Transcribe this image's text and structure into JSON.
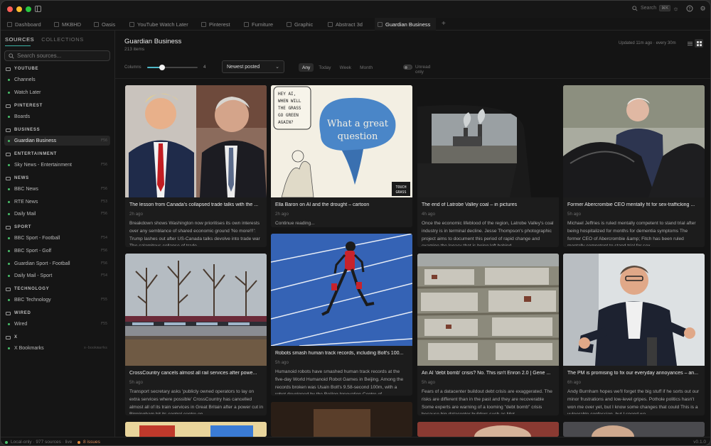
{
  "titlebar": {
    "search_label": "Search",
    "search_shortcut": "⌘K"
  },
  "tabs": [
    {
      "label": "Dashboard",
      "active": false
    },
    {
      "label": "MKBHD",
      "active": false
    },
    {
      "label": "Oasis",
      "active": false
    },
    {
      "label": "YouTube Watch Later",
      "active": false
    },
    {
      "label": "Pinterest",
      "active": false
    },
    {
      "label": "Furniture",
      "active": false
    },
    {
      "label": "Graphic",
      "active": false
    },
    {
      "label": "Abstract 3d",
      "active": false
    },
    {
      "label": "Guardian Business",
      "active": true
    }
  ],
  "sidebar": {
    "tab_sources": "SOURCES",
    "tab_collections": "COLLECTIONS",
    "search_placeholder": "Search sources...",
    "groups": [
      {
        "name": "YOUTUBE",
        "items": [
          {
            "label": "Channels",
            "key": ""
          },
          {
            "label": "Watch Later",
            "key": ""
          }
        ]
      },
      {
        "name": "PINTEREST",
        "items": [
          {
            "label": "Boards",
            "key": ""
          }
        ]
      },
      {
        "name": "BUSINESS",
        "items": [
          {
            "label": "Guardian Business",
            "key": "F56",
            "active": true
          }
        ]
      },
      {
        "name": "ENTERTAINMENT",
        "items": [
          {
            "label": "Sky News - Entertainment",
            "key": "F56"
          }
        ]
      },
      {
        "name": "NEWS",
        "items": [
          {
            "label": "BBC News",
            "key": "F56"
          },
          {
            "label": "RTE News",
            "key": "F53"
          },
          {
            "label": "Daily Mail",
            "key": "F56"
          }
        ]
      },
      {
        "name": "SPORT",
        "items": [
          {
            "label": "BBC Sport - Football",
            "key": "F54"
          },
          {
            "label": "BBC Sport - Golf",
            "key": "F56"
          },
          {
            "label": "Guardian Sport - Football",
            "key": "F56"
          },
          {
            "label": "Daily Mail - Sport",
            "key": "F54"
          }
        ]
      },
      {
        "name": "TECHNOLOGY",
        "items": [
          {
            "label": "BBC Technology",
            "key": "F55"
          }
        ]
      },
      {
        "name": "WIRED",
        "items": [
          {
            "label": "Wired",
            "key": "F55"
          }
        ]
      },
      {
        "name": "X",
        "items": [
          {
            "label": "X Bookmarks",
            "key": "x-bookmarks"
          }
        ]
      }
    ]
  },
  "main": {
    "title": "Guardian Business",
    "count": "213 items",
    "updated": "Updated 11m ago · every 30m",
    "columns_label": "Columns",
    "columns_value": "4",
    "columns_fraction": 0.3,
    "sort_selected": "Newest posted",
    "filters": [
      "Any",
      "Today",
      "Week",
      "Month"
    ],
    "active_filter": "Any",
    "unread_label": "Unread only"
  },
  "cards": [
    {
      "title": "The lesson from Canada's collapsed trade talks with the ...",
      "age": "2h ago",
      "desc": "Breakdown shows Washington now prioritises its own interests over any semblance of shared economic ground 'No more!!!': Trump lashes out after US-Canada talks devolve into trade war The calamitous collapse of trade..."
    },
    {
      "title": "Ella Baron on AI and the drought – cartoon",
      "age": "2h ago",
      "desc": "Continue reading...",
      "cartoon_text": "HEY AI, WHEN WILL THE GRASS GO GREEN AGAIN?",
      "cartoon_big": "What a great question",
      "cartoon_sig": "TOUCH GRASS"
    },
    {
      "title": "The end of Latrobe Valley coal – in pictures",
      "age": "4h ago",
      "desc": "Once the economic lifeblood of the region, Latrobe Valley's coal industry is in terminal decline. Jesse Thompson's photographic project aims to document this period of rapid change and examine the legacy that is being left behind..."
    },
    {
      "title": "Former Abercrombie CEO mentally fit for sex-trafficking ...",
      "age": "5h ago",
      "desc": "Michael Jeffries is ruled mentally competent to stand trial after being hospitalized for months for dementia symptoms The former CEO of Abercrombie &amp; Fitch has been ruled mentally competent to stand trial for sex..."
    },
    {
      "title": "CrossCountry cancels almost all rail services after powe...",
      "age": "5h ago",
      "desc": "Transport secretary asks 'publicly owned operators to lay on extra services where possible' CrossCountry has cancelled almost all of its train services in Great Britain after a power cut in Birmingham hit its control centre on..."
    },
    {
      "title": "Robots smash human track records, including Bolt's 100...",
      "age": "5h ago",
      "desc": "Humanoid robots have smashed human track records at the five-day World Humanoid Robot Games in Beijing. Among the records broken was Usain Bolt's 9.58-second 100m, with a robot developed by the Beijing Innovation Centre of..."
    },
    {
      "title": "An AI 'debt bomb' crisis? No. This isn't Enron 2.0 | Gene ...",
      "age": "5h ago",
      "desc": "Fears of a datacenter buildout debt crisis are exaggerated. The risks are different than in the past and they are recoverable Some experts are warning of a looming \"debt bomb\" crisis because big datacenter builders such as Met..."
    },
    {
      "title": "The PM is promising to fix our everyday annoyances – an...",
      "age": "6h ago",
      "desc": "Andy Burnham hopes we'll forget the big stuff if he sorts out our minor frustrations and low-level gripes. Pothole politics hasn't won me over yet, but I know some changes that could This is a vulnerable confession, but I spend wa..."
    }
  ],
  "status": {
    "live": "Local-only · 977 sources · live",
    "issues": "8 issues",
    "version": "v0.1.0"
  },
  "colors": {
    "accent": "#3bb3a6",
    "live": "#49c06a",
    "issue": "#e08a3c"
  }
}
